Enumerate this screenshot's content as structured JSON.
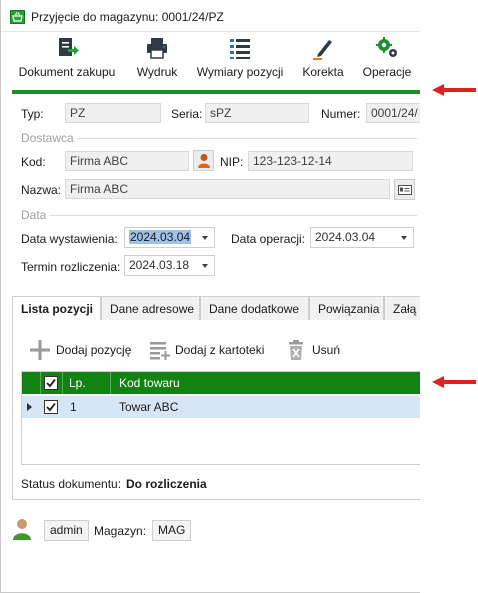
{
  "window": {
    "title": "Przyjęcie do magazynu: 0001/24/PZ"
  },
  "ribbon": {
    "buttons": [
      {
        "label": "Dokument zakupu",
        "icon": "document-export-icon"
      },
      {
        "label": "Wydruk",
        "icon": "printer-icon"
      },
      {
        "label": "Wymiary pozycji",
        "icon": "list-icon"
      },
      {
        "label": "Korekta",
        "icon": "pen-icon"
      },
      {
        "label": "Operacje",
        "icon": "gears-icon"
      }
    ],
    "accent_color": "#1c8b2a"
  },
  "header": {
    "typ_label": "Typ:",
    "typ_value": "PZ",
    "seria_label": "Seria:",
    "seria_value": "sPZ",
    "numer_label": "Numer:",
    "numer_value": "0001/24/"
  },
  "dostawca": {
    "section": "Dostawca",
    "kod_label": "Kod:",
    "kod_value": "Firma ABC",
    "nip_label": "NIP:",
    "nip_value": "123-123-12-14",
    "nazwa_label": "Nazwa:",
    "nazwa_value": "Firma ABC"
  },
  "data": {
    "section": "Data",
    "wystawienia_label": "Data wystawienia:",
    "wystawienia_value": "2024.03.04",
    "operacji_label": "Data operacji:",
    "operacji_value": "2024.03.04",
    "termin_label": "Termin rozliczenia:",
    "termin_value": "2024.03.18"
  },
  "tabs": [
    "Lista pozycji",
    "Dane adresowe",
    "Dane dodatkowe",
    "Powiązania",
    "Załą"
  ],
  "toolbar": {
    "add_label": "Dodaj pozycję",
    "add_from_label": "Dodaj z kartoteki",
    "delete_label": "Usuń"
  },
  "grid": {
    "header_color": "#128312",
    "columns": [
      "Lp.",
      "Kod towaru"
    ],
    "rows": [
      {
        "lp": "1",
        "kod": "Towar ABC",
        "checked": true
      }
    ]
  },
  "status": {
    "label": "Status dokumentu:",
    "value": "Do rozliczenia"
  },
  "footer": {
    "user": "admin",
    "magazyn_label": "Magazyn:",
    "magazyn_value": "MAG"
  },
  "annotations": {
    "arrow_color": "#e02020"
  }
}
